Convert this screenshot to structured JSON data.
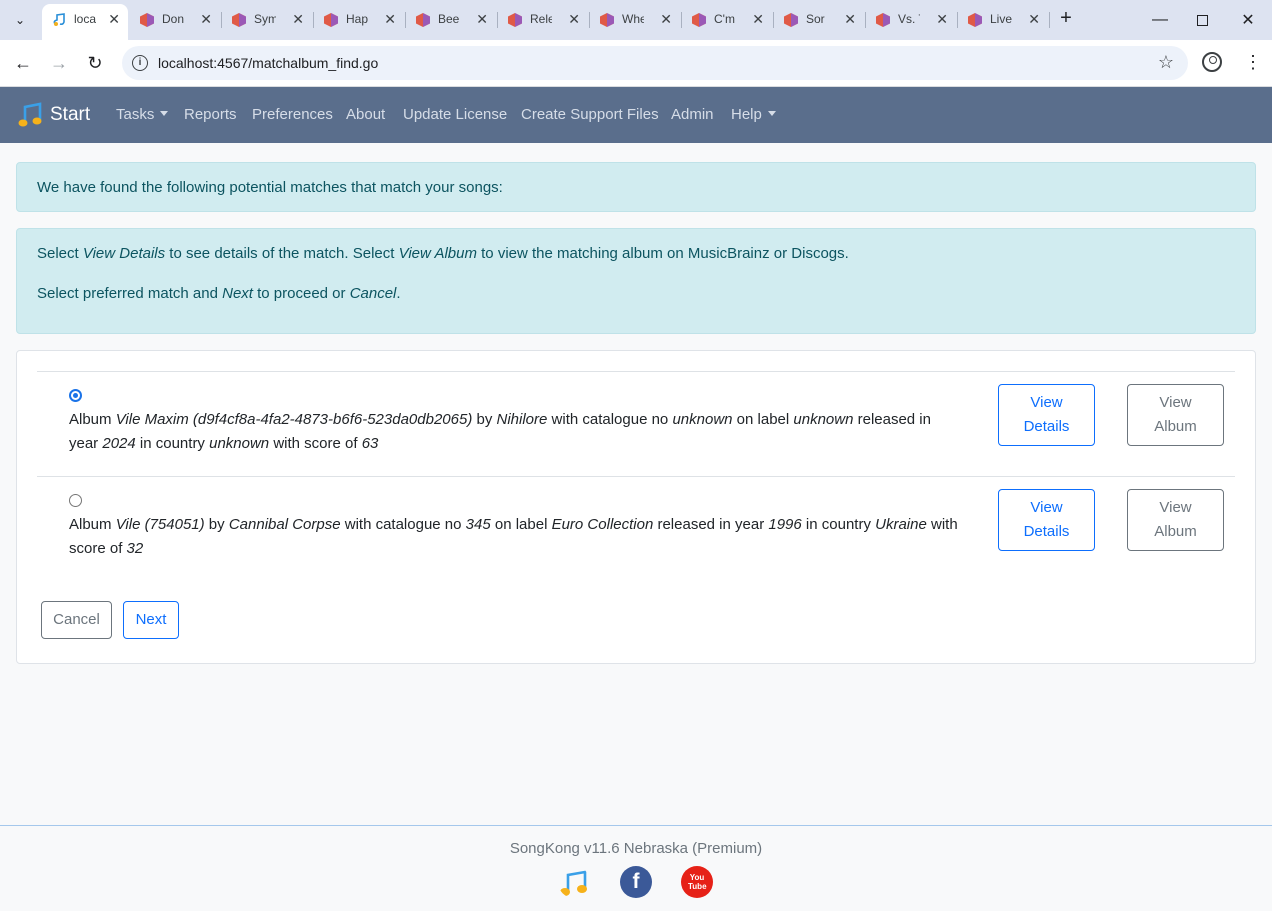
{
  "browser": {
    "tabs": [
      {
        "title": "loca",
        "active": true
      },
      {
        "title": "Don"
      },
      {
        "title": "Sym"
      },
      {
        "title": "Hap"
      },
      {
        "title": "Bee"
      },
      {
        "title": "Rele"
      },
      {
        "title": "Whe"
      },
      {
        "title": "C'm"
      },
      {
        "title": "Sor"
      },
      {
        "title": "Vs. T"
      },
      {
        "title": "Live"
      }
    ],
    "url": "localhost:4567/matchalbum_find.go"
  },
  "navbar": {
    "brand": "Start",
    "items": [
      "Tasks",
      "Reports",
      "Preferences",
      "About",
      "Update License",
      "Create Support Files",
      "Admin",
      "Help"
    ]
  },
  "alert_found": "We have found the following potential matches that match your songs:",
  "instructions": {
    "line1": {
      "a": "Select ",
      "b": "View Details",
      "c": " to see details of the match. Select ",
      "d": "View Album",
      "e": " to view the matching album on MusicBrainz or Discogs."
    },
    "line2": {
      "a": "Select preferred match and ",
      "b": "Next",
      "c": " to proceed or ",
      "d": "Cancel",
      "e": "."
    }
  },
  "matches": [
    {
      "selected": true,
      "album": "Vile Maxim (d9f4cf8a-4fa2-4873-b6f6-523da0db2065)",
      "artist": "Nihilore",
      "catalogue": "unknown",
      "label": "unknown",
      "year": "2024",
      "country": "unknown",
      "score": "63"
    },
    {
      "selected": false,
      "album": "Vile (754051)",
      "artist": "Cannibal Corpse",
      "catalogue": "345",
      "label": "Euro Collection",
      "year": "1996",
      "country": "Ukraine",
      "score": "32"
    }
  ],
  "words": {
    "album": "Album ",
    "by": " by ",
    "catalogue": " with catalogue no ",
    "label": " on label ",
    "year": " released in year ",
    "country": " in country ",
    "score": " with score of "
  },
  "buttons": {
    "view_details": "View Details",
    "view_album": "View Album",
    "cancel": "Cancel",
    "next": "Next"
  },
  "footer": {
    "version": "SongKong v11.6 Nebraska (Premium)",
    "youtube_text": "You Tube"
  },
  "colors": {
    "navbar": "#5a6e8c",
    "alert_bg": "#d1ecf0",
    "alert_text": "#0c5460",
    "primary": "#0d6efd",
    "secondary": "#6c757d"
  }
}
